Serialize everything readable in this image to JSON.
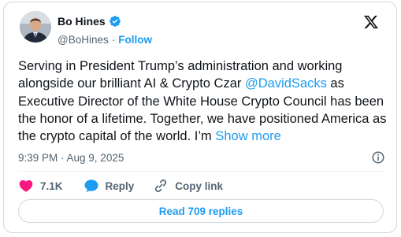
{
  "author": {
    "name": "Bo Hines",
    "handle": "@BoHines",
    "separator": "·",
    "follow_label": "Follow",
    "verified": true
  },
  "tweet": {
    "text_before_mention": "Serving in President Trump’s administration and working alongside our brilliant AI & Crypto Czar ",
    "mention": "@DavidSacks",
    "text_after_mention": " as Executive Director of the White House Crypto Council has been the honor of a lifetime. Together, we have positioned America as the crypto capital of the world. I’m ",
    "show_more_label": "Show more",
    "timestamp": "9:39 PM · Aug 9, 2025"
  },
  "actions": {
    "likes": "7.1K",
    "reply_label": "Reply",
    "copy_link_label": "Copy link"
  },
  "replies_button_label": "Read 709 replies",
  "colors": {
    "accent": "#1d9bf0",
    "like_red": "#f91880",
    "secondary_text": "#536471",
    "border": "#cfd9de"
  },
  "icons": {
    "verified": "verified-badge-icon",
    "logo": "x-logo-icon",
    "info": "info-icon",
    "like": "heart-icon",
    "reply": "reply-bubble-icon",
    "copy_link": "link-icon"
  }
}
